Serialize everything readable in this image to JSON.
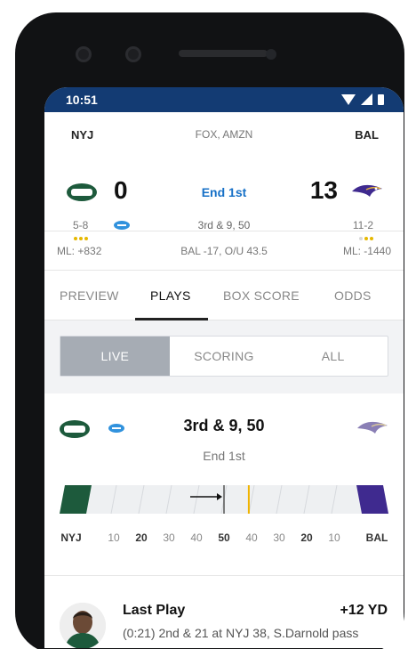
{
  "status_bar": {
    "time": "10:51"
  },
  "game": {
    "away": {
      "abbr": "NYJ",
      "score": "0",
      "record": "5-8",
      "moneyline": "ML: +832",
      "timeouts": 3,
      "timeouts_total": 3
    },
    "home": {
      "abbr": "BAL",
      "score": "13",
      "record": "11-2",
      "moneyline": "ML: -1440",
      "timeouts": 2,
      "timeouts_total": 3
    },
    "network": "FOX, AMZN",
    "period": "End 1st",
    "down_distance": "3rd & 9, 50",
    "spread_total": "BAL -17, O/U 43.5"
  },
  "tabs": [
    {
      "label": "PREVIEW",
      "active": false
    },
    {
      "label": "PLAYS",
      "active": true
    },
    {
      "label": "BOX SCORE",
      "active": false
    },
    {
      "label": "ODDS",
      "active": false
    }
  ],
  "segments": [
    {
      "label": "LIVE",
      "active": true
    },
    {
      "label": "SCORING",
      "active": false
    },
    {
      "label": "ALL",
      "active": false
    }
  ],
  "current_play": {
    "title": "3rd & 9, 50",
    "subtitle": "End 1st",
    "ball_on_yard": 50,
    "first_down_yard": 41
  },
  "field_labels": [
    {
      "text": "NYJ",
      "type": "team"
    },
    {
      "text": "10",
      "type": "normal"
    },
    {
      "text": "20",
      "type": "bold"
    },
    {
      "text": "30",
      "type": "normal"
    },
    {
      "text": "40",
      "type": "normal"
    },
    {
      "text": "50",
      "type": "bold"
    },
    {
      "text": "40",
      "type": "normal"
    },
    {
      "text": "30",
      "type": "normal"
    },
    {
      "text": "20",
      "type": "bold"
    },
    {
      "text": "10",
      "type": "normal"
    },
    {
      "text": "BAL",
      "type": "team"
    }
  ],
  "last_play": {
    "title": "Last Play",
    "gain": "+12 YD",
    "description": "(0:21) 2nd & 21 at NYJ 38, S.Darnold pass"
  },
  "colors": {
    "status_bar": "#133b73",
    "nyj": "#1d5a3c",
    "bal": "#3f2a8f",
    "accent": "#1670c7",
    "first_down_line": "#f0b400"
  }
}
